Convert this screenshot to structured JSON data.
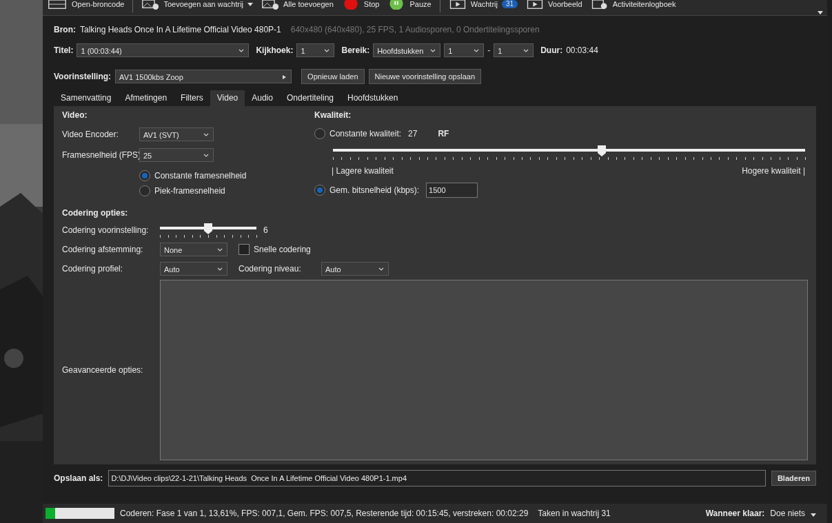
{
  "toolbar": [
    {
      "label": "Open-broncode",
      "kind": "source"
    },
    {
      "label": "Toevoegen aan wachtrij",
      "kind": "add",
      "dropdown": true
    },
    {
      "label": "Alle toevoegen",
      "kind": "add"
    },
    {
      "label": "Stop",
      "kind": "stop"
    },
    {
      "label": "Pauze",
      "kind": "pause"
    },
    {
      "label": "Wachtrij",
      "kind": "queue",
      "badge": "31"
    },
    {
      "label": "Voorbeeld",
      "kind": "preview"
    },
    {
      "label": "Activiteitenlogboek",
      "kind": "log"
    }
  ],
  "source": {
    "label": "Bron:",
    "name": "Talking Heads  Once In A Lifetime Official Video 480P-1",
    "info": "640x480 (640x480), 25 FPS, 1 Audiosporen, 0 Ondertitelingssporen"
  },
  "title_row": {
    "title_label": "Titel:",
    "title": "1  (00:03:44)",
    "angle_label": "Kijkhoek:",
    "angle": "1",
    "range_label": "Bereik:",
    "range_type": "Hoofdstukken",
    "range_from": "1",
    "range_sep": "-",
    "range_to": "1",
    "duration_label": "Duur:",
    "duration": "00:03:44"
  },
  "preset": {
    "label": "Voorinstelling:",
    "value": "AV1 1500kbs Zoop",
    "buttons": [
      "Opnieuw laden",
      "Nieuwe voorinstelling opslaan"
    ]
  },
  "tabs": [
    {
      "label": "Samenvatting",
      "selected": false
    },
    {
      "label": "Afmetingen",
      "selected": false
    },
    {
      "label": "Filters",
      "selected": false
    },
    {
      "label": "Video",
      "selected": true
    },
    {
      "label": "Audio",
      "selected": false
    },
    {
      "label": "Ondertiteling",
      "selected": false
    },
    {
      "label": "Hoofdstukken",
      "selected": false
    }
  ],
  "video": {
    "heading": "Video:",
    "encoder_label": "Video Encoder:",
    "encoder": "AV1 (SVT)",
    "fps_label": "Framesnelheid (FPS)",
    "fps": "25",
    "fps_modes": [
      {
        "label": "Constante framesnelheid",
        "selected": true
      },
      {
        "label": "Piek-framesnelheid",
        "selected": false
      }
    ]
  },
  "quality": {
    "heading": "Kwaliteit:",
    "cq": {
      "label": "Constante kwaliteit:",
      "value": "27",
      "unit": "RF",
      "selected": false
    },
    "level": 0.57,
    "low_label": "| Lagere kwaliteit",
    "high_label": "Hogere kwaliteit |",
    "bitrate": {
      "label": "Gem. bitsnelheid (kbps):",
      "value": "1500",
      "selected": true
    }
  },
  "encoding": {
    "heading": "Codering opties:",
    "preset_label": "Codering voorinstelling:",
    "level": 0.5,
    "preset_value": "6",
    "tune_label": "Codering afstemming:",
    "tune": "None",
    "fast": {
      "label": "Snelle codering",
      "checked": false
    },
    "profile_label": "Codering profiel:",
    "profile": "Auto",
    "level_label": "Codering niveau:",
    "level_value": "Auto",
    "advanced_label": "Geavanceerde opties:"
  },
  "save": {
    "label": "Opslaan als:",
    "path": "D:\\DJ\\Video clips\\22-1-21\\Talking Heads  Once In A Lifetime Official Video 480P1-1.mp4",
    "button": "Bladeren"
  },
  "status_bar": {
    "level": 0.14,
    "text": "Coderen: Fase 1 van 1, 13,61%, FPS: 007,1, Gem. FPS: 007,5, Resterende tijd: 00:15:45, verstreken: 00:02:29",
    "queue": "Taken in wachtrij 31",
    "when_label": "Wanneer klaar:",
    "when": "Doe niets"
  }
}
